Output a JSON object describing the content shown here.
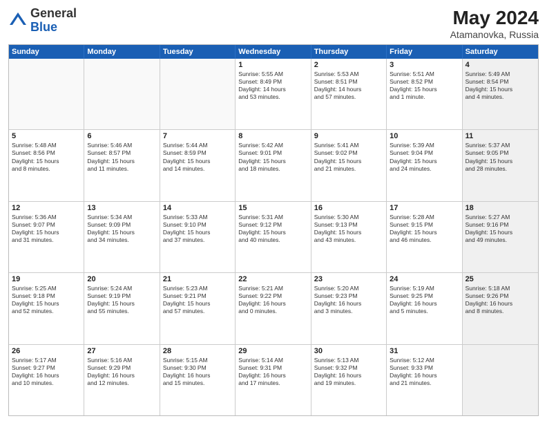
{
  "header": {
    "logo_general": "General",
    "logo_blue": "Blue",
    "title": "May 2024",
    "subtitle": "Atamanovka, Russia"
  },
  "days_of_week": [
    "Sunday",
    "Monday",
    "Tuesday",
    "Wednesday",
    "Thursday",
    "Friday",
    "Saturday"
  ],
  "rows": [
    [
      {
        "day": "",
        "empty": true
      },
      {
        "day": "",
        "empty": true
      },
      {
        "day": "",
        "empty": true
      },
      {
        "day": "1",
        "lines": [
          "Sunrise: 5:55 AM",
          "Sunset: 8:49 PM",
          "Daylight: 14 hours",
          "and 53 minutes."
        ]
      },
      {
        "day": "2",
        "lines": [
          "Sunrise: 5:53 AM",
          "Sunset: 8:51 PM",
          "Daylight: 14 hours",
          "and 57 minutes."
        ]
      },
      {
        "day": "3",
        "lines": [
          "Sunrise: 5:51 AM",
          "Sunset: 8:52 PM",
          "Daylight: 15 hours",
          "and 1 minute."
        ]
      },
      {
        "day": "4",
        "lines": [
          "Sunrise: 5:49 AM",
          "Sunset: 8:54 PM",
          "Daylight: 15 hours",
          "and 4 minutes."
        ],
        "shaded": true
      }
    ],
    [
      {
        "day": "5",
        "lines": [
          "Sunrise: 5:48 AM",
          "Sunset: 8:56 PM",
          "Daylight: 15 hours",
          "and 8 minutes."
        ]
      },
      {
        "day": "6",
        "lines": [
          "Sunrise: 5:46 AM",
          "Sunset: 8:57 PM",
          "Daylight: 15 hours",
          "and 11 minutes."
        ]
      },
      {
        "day": "7",
        "lines": [
          "Sunrise: 5:44 AM",
          "Sunset: 8:59 PM",
          "Daylight: 15 hours",
          "and 14 minutes."
        ]
      },
      {
        "day": "8",
        "lines": [
          "Sunrise: 5:42 AM",
          "Sunset: 9:01 PM",
          "Daylight: 15 hours",
          "and 18 minutes."
        ]
      },
      {
        "day": "9",
        "lines": [
          "Sunrise: 5:41 AM",
          "Sunset: 9:02 PM",
          "Daylight: 15 hours",
          "and 21 minutes."
        ]
      },
      {
        "day": "10",
        "lines": [
          "Sunrise: 5:39 AM",
          "Sunset: 9:04 PM",
          "Daylight: 15 hours",
          "and 24 minutes."
        ]
      },
      {
        "day": "11",
        "lines": [
          "Sunrise: 5:37 AM",
          "Sunset: 9:05 PM",
          "Daylight: 15 hours",
          "and 28 minutes."
        ],
        "shaded": true
      }
    ],
    [
      {
        "day": "12",
        "lines": [
          "Sunrise: 5:36 AM",
          "Sunset: 9:07 PM",
          "Daylight: 15 hours",
          "and 31 minutes."
        ]
      },
      {
        "day": "13",
        "lines": [
          "Sunrise: 5:34 AM",
          "Sunset: 9:09 PM",
          "Daylight: 15 hours",
          "and 34 minutes."
        ]
      },
      {
        "day": "14",
        "lines": [
          "Sunrise: 5:33 AM",
          "Sunset: 9:10 PM",
          "Daylight: 15 hours",
          "and 37 minutes."
        ]
      },
      {
        "day": "15",
        "lines": [
          "Sunrise: 5:31 AM",
          "Sunset: 9:12 PM",
          "Daylight: 15 hours",
          "and 40 minutes."
        ]
      },
      {
        "day": "16",
        "lines": [
          "Sunrise: 5:30 AM",
          "Sunset: 9:13 PM",
          "Daylight: 15 hours",
          "and 43 minutes."
        ]
      },
      {
        "day": "17",
        "lines": [
          "Sunrise: 5:28 AM",
          "Sunset: 9:15 PM",
          "Daylight: 15 hours",
          "and 46 minutes."
        ]
      },
      {
        "day": "18",
        "lines": [
          "Sunrise: 5:27 AM",
          "Sunset: 9:16 PM",
          "Daylight: 15 hours",
          "and 49 minutes."
        ],
        "shaded": true
      }
    ],
    [
      {
        "day": "19",
        "lines": [
          "Sunrise: 5:25 AM",
          "Sunset: 9:18 PM",
          "Daylight: 15 hours",
          "and 52 minutes."
        ]
      },
      {
        "day": "20",
        "lines": [
          "Sunrise: 5:24 AM",
          "Sunset: 9:19 PM",
          "Daylight: 15 hours",
          "and 55 minutes."
        ]
      },
      {
        "day": "21",
        "lines": [
          "Sunrise: 5:23 AM",
          "Sunset: 9:21 PM",
          "Daylight: 15 hours",
          "and 57 minutes."
        ]
      },
      {
        "day": "22",
        "lines": [
          "Sunrise: 5:21 AM",
          "Sunset: 9:22 PM",
          "Daylight: 16 hours",
          "and 0 minutes."
        ]
      },
      {
        "day": "23",
        "lines": [
          "Sunrise: 5:20 AM",
          "Sunset: 9:23 PM",
          "Daylight: 16 hours",
          "and 3 minutes."
        ]
      },
      {
        "day": "24",
        "lines": [
          "Sunrise: 5:19 AM",
          "Sunset: 9:25 PM",
          "Daylight: 16 hours",
          "and 5 minutes."
        ]
      },
      {
        "day": "25",
        "lines": [
          "Sunrise: 5:18 AM",
          "Sunset: 9:26 PM",
          "Daylight: 16 hours",
          "and 8 minutes."
        ],
        "shaded": true
      }
    ],
    [
      {
        "day": "26",
        "lines": [
          "Sunrise: 5:17 AM",
          "Sunset: 9:27 PM",
          "Daylight: 16 hours",
          "and 10 minutes."
        ]
      },
      {
        "day": "27",
        "lines": [
          "Sunrise: 5:16 AM",
          "Sunset: 9:29 PM",
          "Daylight: 16 hours",
          "and 12 minutes."
        ]
      },
      {
        "day": "28",
        "lines": [
          "Sunrise: 5:15 AM",
          "Sunset: 9:30 PM",
          "Daylight: 16 hours",
          "and 15 minutes."
        ]
      },
      {
        "day": "29",
        "lines": [
          "Sunrise: 5:14 AM",
          "Sunset: 9:31 PM",
          "Daylight: 16 hours",
          "and 17 minutes."
        ]
      },
      {
        "day": "30",
        "lines": [
          "Sunrise: 5:13 AM",
          "Sunset: 9:32 PM",
          "Daylight: 16 hours",
          "and 19 minutes."
        ]
      },
      {
        "day": "31",
        "lines": [
          "Sunrise: 5:12 AM",
          "Sunset: 9:33 PM",
          "Daylight: 16 hours",
          "and 21 minutes."
        ]
      },
      {
        "day": "",
        "empty": true,
        "shaded": true
      }
    ]
  ]
}
